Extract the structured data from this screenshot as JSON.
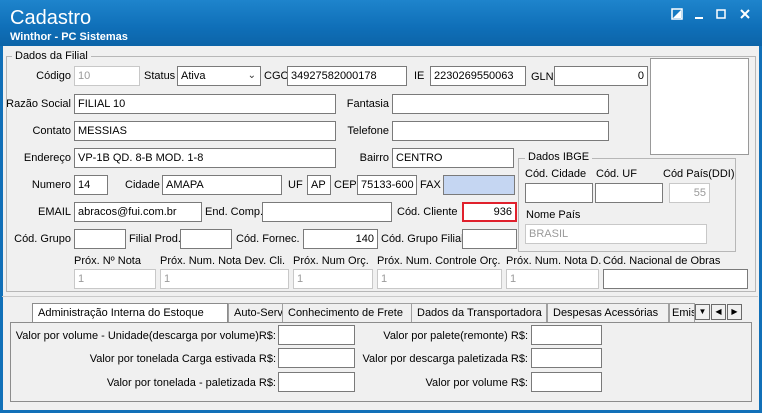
{
  "window": {
    "title": "Cadastro",
    "subtitle": "Winthor - PC Sistemas",
    "controls": [
      "restore-icon",
      "minimize-icon",
      "maximize-icon",
      "close-icon"
    ]
  },
  "filial": {
    "group_label": "Dados da Filial",
    "codigo_label": "Código",
    "codigo_value": "10",
    "status_label": "Status",
    "status_value": "Ativa",
    "cgc_label": "CGC",
    "cgc_value": "34927582000178",
    "ie_label": "IE",
    "ie_value": "2230269550063",
    "gln_label": "GLN",
    "gln_value": "0",
    "razao_label": "Razão Social",
    "razao_value": "FILIAL 10",
    "fantasia_label": "Fantasia",
    "fantasia_value": "",
    "contato_label": "Contato",
    "contato_value": "MESSIAS",
    "telefone_label": "Telefone",
    "telefone_value": "",
    "endereco_label": "Endereço",
    "endereco_value": "VP-1B QD. 8-B MOD. 1-8",
    "bairro_label": "Bairro",
    "bairro_value": "CENTRO",
    "numero_label": "Numero",
    "numero_value": "14",
    "cidade_label": "Cidade",
    "cidade_value": "AMAPA",
    "uf_label": "UF",
    "uf_value": "AP",
    "cep_label": "CEP",
    "cep_value": "75133-600",
    "fax_label": "FAX",
    "fax_value": "",
    "email_label": "EMAIL",
    "email_value": "abracos@fui.com.br",
    "endcomp_label": "End. Comp.",
    "endcomp_value": "",
    "codcliente_label": "Cód. Cliente",
    "codcliente_value": "936",
    "codgrupo_label": "Cód. Grupo",
    "codgrupo_value": "",
    "filialprod_label": "Filial Prod.",
    "filialprod_value": "",
    "codfornec_label": "Cód. Fornec.",
    "codfornec_value": "140",
    "codgrupofilial_label": "Cód. Grupo Filial",
    "codgrupofilial_value": "",
    "proxnota_label": "Próx. Nº Nota",
    "proxnota_value": "1",
    "proxnumdev_label": "Próx. Num. Nota Dev. Cli.",
    "proxnumdev_value": "1",
    "proxnumorc_label": "Próx. Num Orç.",
    "proxnumorc_value": "1",
    "proxcontroleorc_label": "Próx. Num. Controle Orç.",
    "proxcontroleorc_value": "1",
    "proxnotad_label": "Próx. Num. Nota D.",
    "proxnotad_value": "1",
    "codobras_label": "Cód. Nacional de Obras",
    "codobras_value": ""
  },
  "ibge": {
    "group_label": "Dados IBGE",
    "cidade_label": "Cód. Cidade",
    "cidade_value": "",
    "uf_label": "Cód. UF",
    "uf_value": "",
    "pais_label": "Cód País(DDI)",
    "pais_value": "55",
    "nome_pais_label": "Nome País",
    "nome_pais_value": "BRASIL"
  },
  "tabs": [
    {
      "label": "Administração Interna do Estoque",
      "active": true
    },
    {
      "label": "Auto-Serviço"
    },
    {
      "label": "Conhecimento de Frete"
    },
    {
      "label": "Dados da Transportadora"
    },
    {
      "label": "Despesas Acessórias"
    },
    {
      "label": "Emiss"
    }
  ],
  "estoque": {
    "volume_descarga_label": "Valor por volume - Unidade(descarga por volume)R$:",
    "volume_descarga_value": "",
    "palete_remonte_label": "Valor por palete(remonte) R$:",
    "palete_remonte_value": "",
    "tonelada_carga_label": "Valor por tonelada Carga estivada R$:",
    "tonelada_carga_value": "",
    "descarga_paletizada_label": "Valor por descarga paletizada R$:",
    "descarga_paletizada_value": "",
    "tonelada_paletizada_label": "Valor por tonelada - paletizada R$:",
    "tonelada_paletizada_value": "",
    "por_volume_label": "Valor por volume R$:",
    "por_volume_value": ""
  },
  "colors": {
    "titlebar": "#0f6fb8",
    "highlight_border": "#e0202c",
    "selected_field": "#c5d6f2"
  }
}
